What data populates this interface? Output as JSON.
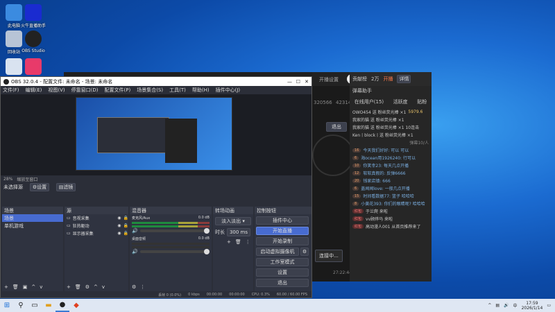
{
  "desktop": {
    "icons": [
      {
        "label": "此电脑",
        "color": "#3b8be0"
      },
      {
        "label": "火牛直播助手",
        "color": "#1a2bd0"
      },
      {
        "label": "回收站",
        "color": "#b7c4d6"
      },
      {
        "label": "OBS Studio",
        "color": "#222"
      },
      {
        "label": "",
        "color": "#d9e3f0"
      },
      {
        "label": "",
        "color": "#e83a6a"
      }
    ]
  },
  "obs": {
    "title": "OBS 32.0.4 - 配置文件: 未命名 - 场景: 未命名",
    "menu": [
      "文件(F)",
      "编辑(E)",
      "视图(V)",
      "停靠窗口(D)",
      "配置文件(P)",
      "场景集合(S)",
      "工具(T)",
      "帮助(H)",
      "插件中心(J)"
    ],
    "no_source": "未选择源",
    "props": "设置",
    "filters": "滤镜",
    "scenes": {
      "title": "场景",
      "items": [
        "场景",
        "单机游戏"
      ]
    },
    "sources": {
      "title": "源",
      "items": [
        "音视采集",
        "狂热躯动",
        "显示器采集"
      ]
    },
    "mixer": {
      "title": "混音器",
      "tracks": [
        {
          "name": "麦克风/Aux",
          "db": "0.0 dB"
        },
        {
          "name": "桌面音频",
          "db": "0.0 dB"
        }
      ]
    },
    "transitions": {
      "title": "转场动画",
      "type": "淡入淡出",
      "duration_label": "时长",
      "duration": "300 ms"
    },
    "controls": {
      "title": "控制按钮",
      "buttons": [
        "插件中心",
        "开始直播",
        "开始录制",
        "启动虚拟摄像机",
        "工作室模式",
        "设置",
        "退出"
      ]
    },
    "zoom": "28%",
    "zoom_tool": "缩放至窗口",
    "status": {
      "frames": "丢帧 0 (0.0%)",
      "kbps": "0 kbps",
      "rec": "00:00:00",
      "stream": "00:00:00",
      "cpu": "CPU: 0.3%",
      "fps": "60.00 / 60.00 FPS"
    }
  },
  "live": {
    "top_label": "开播设置",
    "tabs": [
      "在线用户(15)",
      "活跃度",
      "贴粉"
    ],
    "tab_title": "弹幕助手",
    "top_right": [
      "贡献榜",
      "2万",
      "开播",
      "详情"
    ],
    "ids": [
      "320566",
      "423143"
    ],
    "exit": "退出",
    "start_btn": "连接中...",
    "time": "27:22:44",
    "share": "分享",
    "gifts": [
      "OWO454 送 粉丝荧光棒 ×1",
      "我家的猫 送 粉丝荧光棒 ×1",
      "我家的猫 送 粉丝荧光棒 ×1 10连击",
      "Ken丨block丨送 粉丝荧光棒 ×1"
    ],
    "coins": "5979.6",
    "gift_note": "弹幕10/人",
    "messages": [
      {
        "lv": "16",
        "text": "今天我们好好: 可以 可以"
      },
      {
        "lv": "6",
        "text": "海ocean用1926240: 行可以"
      },
      {
        "lv": "10",
        "text": "你笑幸23: 每天几点开播"
      },
      {
        "lv": "12",
        "text": "软软真假的: 反弹6666"
      },
      {
        "lv": "20",
        "text": "钱家店镇: 666"
      },
      {
        "lv": "6",
        "text": "盖闻闻love: 一般几点开播"
      },
      {
        "lv": "15",
        "text": "时间看数据77: 篮子 哈哈哈"
      },
      {
        "lv": "8",
        "text": "小黄花393: 你们的眼睛呢? 哈哈哈"
      },
      {
        "lv": "红包",
        "text": "于兰爬 来啦"
      },
      {
        "lv": "红包",
        "text": "vv顾烨马 来啦"
      },
      {
        "lv": "红包",
        "text": "高动漫人001 从首页推荐来了"
      }
    ]
  },
  "taskbar": {
    "time": "17:59",
    "date": "2026/1/14",
    "lang": "中"
  }
}
